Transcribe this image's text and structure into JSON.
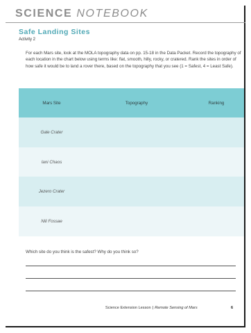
{
  "header": {
    "title_bold": "SCIENCE",
    "title_italic": "NOTEBOOK"
  },
  "activity_title": "Safe Landing Sites",
  "activity_label": "Activity 2",
  "instructions": "For each Mars site, look at the MOLA topography data on pp. 15-18 in the Data Packet. Record the topography of each location in the chart below using terms like: flat, smooth, hilly, rocky, or cratered. Rank the sites in order of how safe it would be to land a rover there, based on the topography that you see (1 = Safest, 4 = Least Safe).",
  "table": {
    "headers": [
      "Mars Site",
      "Topography",
      "Ranking"
    ],
    "rows": [
      {
        "site": "Gale Crater",
        "topography": "",
        "ranking": ""
      },
      {
        "site": "Iani Chaos",
        "topography": "",
        "ranking": ""
      },
      {
        "site": "Jezero Crater",
        "topography": "",
        "ranking": ""
      },
      {
        "site": "Nili Fossae",
        "topography": "",
        "ranking": ""
      }
    ]
  },
  "question": "Which site do you think is the safest? Why do you think so?",
  "footer": {
    "lesson": "Science Extension Lesson",
    "separator": "|",
    "subtitle": "Remote Sensing of Mars",
    "page_number": "6"
  },
  "colors": {
    "accent": "#4fa8b5",
    "table_header": "#7dcdd4",
    "row_dark": "#d8eef1",
    "row_light": "#edf6f8"
  }
}
